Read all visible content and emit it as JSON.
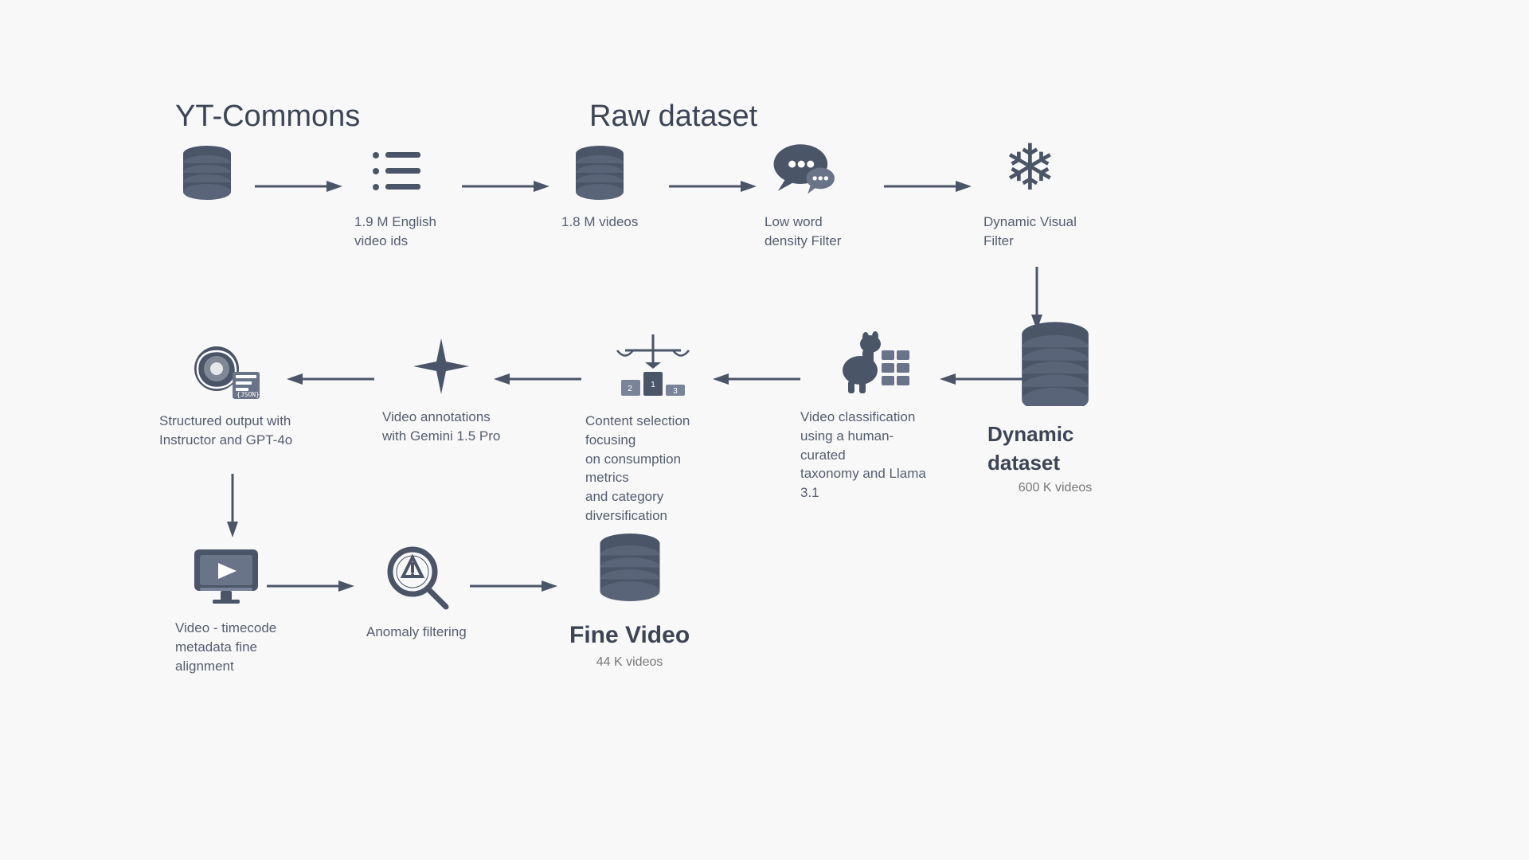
{
  "title1": "YT-Commons",
  "title2": "Raw dataset",
  "nodes": {
    "row1": [
      {
        "id": "yt-commons-db",
        "label": "",
        "sublabel": ""
      },
      {
        "id": "video-ids",
        "label": "1.9 M English\nvideo ids",
        "sublabel": ""
      },
      {
        "id": "raw-db",
        "label": "1.8 M videos",
        "sublabel": ""
      },
      {
        "id": "low-word-filter",
        "label": "Low word\ndensity Filter",
        "sublabel": ""
      },
      {
        "id": "dynamic-visual-filter",
        "label": "Dynamic Visual\nFilter",
        "sublabel": ""
      }
    ],
    "row2": [
      {
        "id": "gpt-output",
        "label": "Structured output with\nInstructor and GPT-4o",
        "sublabel": ""
      },
      {
        "id": "gemini-star",
        "label": "Video annotations\nwith Gemini 1.5 Pro",
        "sublabel": ""
      },
      {
        "id": "content-selection",
        "label": "Content selection focusing\non consumption metrics\nand category diversification",
        "sublabel": ""
      },
      {
        "id": "llama-class",
        "label": "Video classification\nusing a human-curated\ntaxonomy and Llama 3.1",
        "sublabel": ""
      },
      {
        "id": "dynamic-dataset",
        "label": "Dynamic dataset",
        "sublabel": "600 K videos"
      }
    ],
    "row3": [
      {
        "id": "timecode",
        "label": "Video - timecode\nmetadata fine\nalignment",
        "sublabel": ""
      },
      {
        "id": "anomaly",
        "label": "Anomaly filtering",
        "sublabel": ""
      },
      {
        "id": "fine-video",
        "label": "Fine Video",
        "sublabel": "44 K videos"
      }
    ]
  }
}
